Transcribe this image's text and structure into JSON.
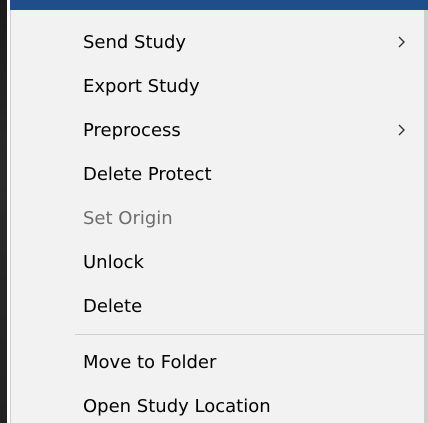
{
  "menu": {
    "items": [
      {
        "label": "Send Study",
        "has_submenu": true,
        "enabled": true
      },
      {
        "label": "Export Study",
        "has_submenu": false,
        "enabled": true
      },
      {
        "label": "Preprocess",
        "has_submenu": true,
        "enabled": true
      },
      {
        "label": "Delete Protect",
        "has_submenu": false,
        "enabled": true
      },
      {
        "label": "Set Origin",
        "has_submenu": false,
        "enabled": false
      },
      {
        "label": "Unlock",
        "has_submenu": false,
        "enabled": true
      },
      {
        "label": "Delete",
        "has_submenu": false,
        "enabled": true
      },
      {
        "label": "Move to Folder",
        "has_submenu": false,
        "enabled": true
      },
      {
        "label": "Open Study Location",
        "has_submenu": false,
        "enabled": true
      }
    ],
    "icons": {
      "submenu": "chevron-right-icon"
    }
  },
  "colors": {
    "menu_background": "#f2f2f2",
    "text": "#000000",
    "disabled_text": "#6d6d6d",
    "separator": "#cfcfcf"
  }
}
